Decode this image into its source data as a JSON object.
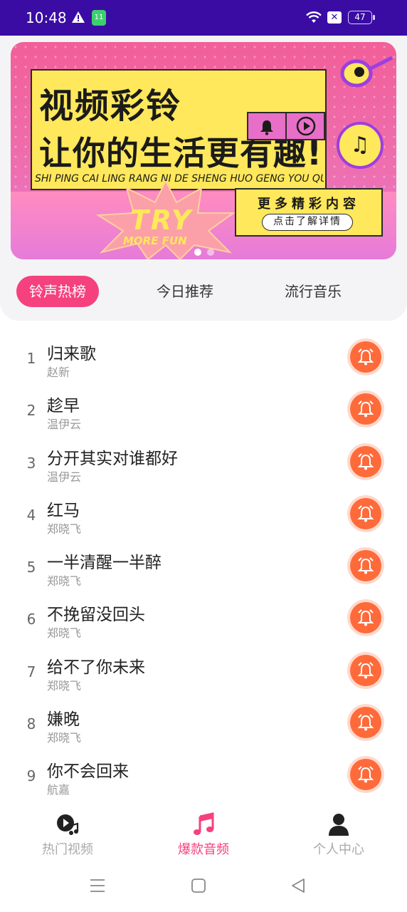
{
  "status_bar": {
    "time": "10:48",
    "sim_label": "11",
    "battery": "47",
    "background": "#3a0ca3"
  },
  "banner": {
    "line1": "视频彩铃",
    "line2": "让你的生活更有趣!",
    "pinyin": "SHI PING CAI LING RANG NI DE SHENG HUO GENG YOU QU",
    "info_title": "更多精彩内容",
    "info_button": "点击了解详情",
    "try_text": "TRY",
    "more_fun": "MORE FUN",
    "colors": {
      "pink": "#f25f99",
      "yellow": "#ffe85b",
      "purple": "#9b3fe0"
    }
  },
  "tabs": [
    {
      "label": "铃声热榜",
      "active": true
    },
    {
      "label": "今日推荐",
      "active": false
    },
    {
      "label": "流行音乐",
      "active": false
    }
  ],
  "songs": [
    {
      "rank": "1",
      "title": "归来歌",
      "artist": "赵新"
    },
    {
      "rank": "2",
      "title": "趁早",
      "artist": "温伊云"
    },
    {
      "rank": "3",
      "title": "分开其实对谁都好",
      "artist": "温伊云"
    },
    {
      "rank": "4",
      "title": "红马",
      "artist": "郑晓飞"
    },
    {
      "rank": "5",
      "title": "一半清醒一半醉",
      "artist": "郑晓飞"
    },
    {
      "rank": "6",
      "title": "不挽留没回头",
      "artist": "郑晓飞"
    },
    {
      "rank": "7",
      "title": "给不了你未来",
      "artist": "郑晓飞"
    },
    {
      "rank": "8",
      "title": "嫌晚",
      "artist": "郑晓飞"
    },
    {
      "rank": "9",
      "title": "你不会回来",
      "artist": "航嘉"
    }
  ],
  "bottom_nav": [
    {
      "label": "热门视频",
      "icon": "video-music-icon",
      "active": false
    },
    {
      "label": "爆款音频",
      "icon": "music-note-icon",
      "active": true
    },
    {
      "label": "个人中心",
      "icon": "person-icon",
      "active": false
    }
  ],
  "accent_color": "#f5417d",
  "ring_color": "#ff6a3a"
}
